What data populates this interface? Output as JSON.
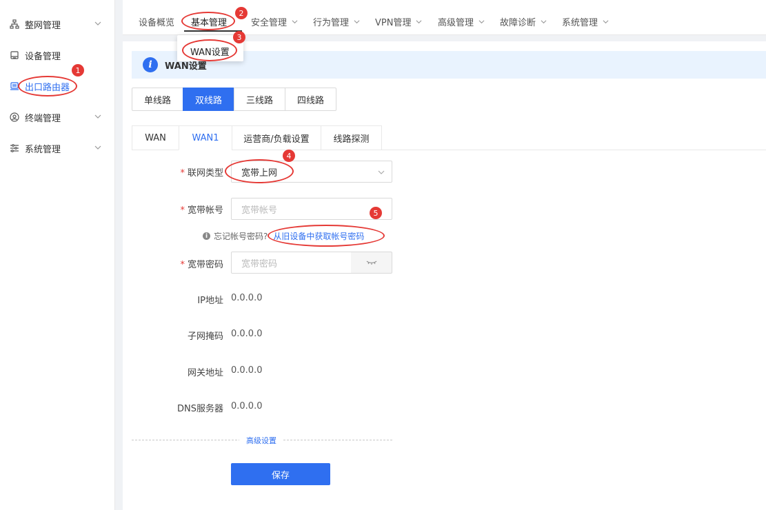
{
  "sidebar": {
    "items": [
      {
        "label": "整网管理",
        "icon": "network-topology-icon",
        "has_chevron": true
      },
      {
        "label": "设备管理",
        "icon": "device-icon",
        "has_chevron": false
      },
      {
        "label": "出口路由器",
        "icon": "router-icon",
        "has_chevron": false,
        "active": true
      },
      {
        "label": "终端管理",
        "icon": "user-icon",
        "has_chevron": true
      },
      {
        "label": "系统管理",
        "icon": "settings-sliders-icon",
        "has_chevron": true
      }
    ]
  },
  "topnav": {
    "items": [
      "设备概览",
      "基本管理",
      "安全管理",
      "行为管理",
      "VPN管理",
      "高级管理",
      "故障诊断",
      "系统管理"
    ],
    "active": "基本管理"
  },
  "dropdown": {
    "items": [
      "WAN设置"
    ]
  },
  "info": {
    "title": "WAN设置",
    "icon": "info-icon"
  },
  "line_mode": {
    "options": [
      "单线路",
      "双线路",
      "三线路",
      "四线路"
    ],
    "selected": "双线路"
  },
  "wan_tabs": {
    "items": [
      "WAN",
      "WAN1",
      "运营商/负载设置",
      "线路探测"
    ],
    "active": "WAN1"
  },
  "form": {
    "connection_type": {
      "label": "联网类型",
      "value": "宽带上网"
    },
    "account": {
      "label": "宽带帐号",
      "placeholder": "宽带帐号"
    },
    "hint": {
      "text": "忘记帐号密码?",
      "link": "从旧设备中获取帐号密码"
    },
    "password": {
      "label": "宽带密码",
      "placeholder": "宽带密码"
    },
    "ip": {
      "label": "IP地址",
      "value": "0.0.0.0"
    },
    "mask": {
      "label": "子网掩码",
      "value": "0.0.0.0"
    },
    "gateway": {
      "label": "网关地址",
      "value": "0.0.0.0"
    },
    "dns": {
      "label": "DNS服务器",
      "value": "0.0.0.0"
    }
  },
  "advanced_label": "高级设置",
  "save_label": "保存",
  "annotations": {
    "badges": [
      "1",
      "2",
      "3",
      "4",
      "5"
    ],
    "color": "#e53935"
  },
  "colors": {
    "accent": "#2f6ff0",
    "info_bg": "#e9f3fe"
  }
}
